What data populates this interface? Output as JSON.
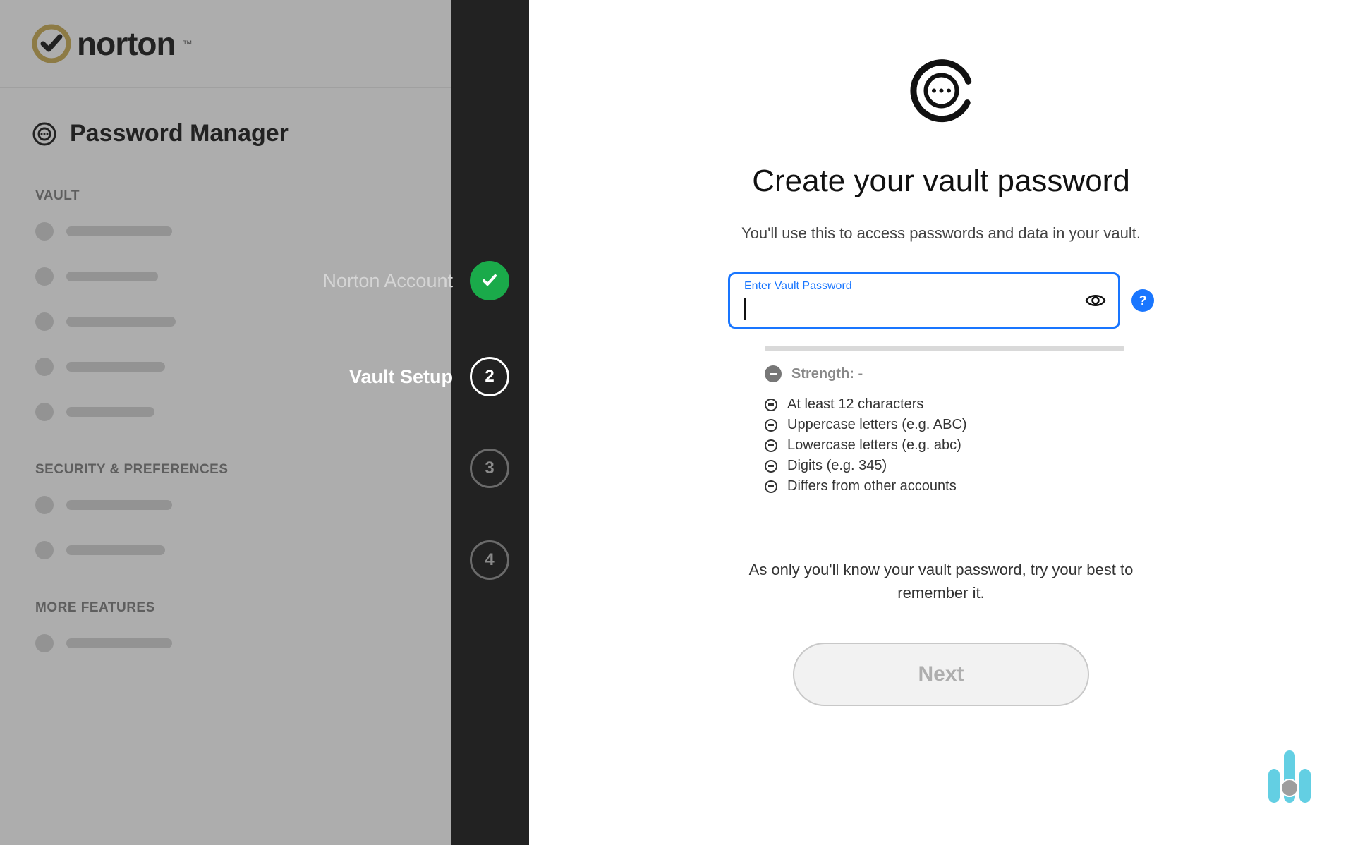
{
  "brand": {
    "name": "norton",
    "tm": "™"
  },
  "product": "Password Manager",
  "sidebar_sections": {
    "vault": "VAULT",
    "security": "SECURITY & PREFERENCES",
    "more": "MORE FEATURES"
  },
  "steps": [
    {
      "label": "Norton Account",
      "state": "done"
    },
    {
      "label": "Vault Setup",
      "state": "current",
      "num": "2"
    },
    {
      "label": "",
      "state": "pending",
      "num": "3"
    },
    {
      "label": "",
      "state": "pending",
      "num": "4"
    }
  ],
  "main": {
    "title": "Create your vault password",
    "subtitle": "You'll use this to access passwords and data in your vault.",
    "input_label": "Enter Vault Password",
    "input_value": "",
    "help_symbol": "?",
    "strength_label": "Strength",
    "strength_value": "-",
    "requirements": [
      "At least 12 characters",
      "Uppercase letters (e.g. ABC)",
      "Lowercase letters (e.g. abc)",
      "Digits (e.g. 345)",
      "Differs from other accounts"
    ],
    "note": "As only you'll know your vault password, try your best to remember it.",
    "next_label": "Next"
  },
  "colors": {
    "accent_blue": "#1976ff",
    "step_done": "#1aaa4a",
    "dark": "#222222"
  }
}
